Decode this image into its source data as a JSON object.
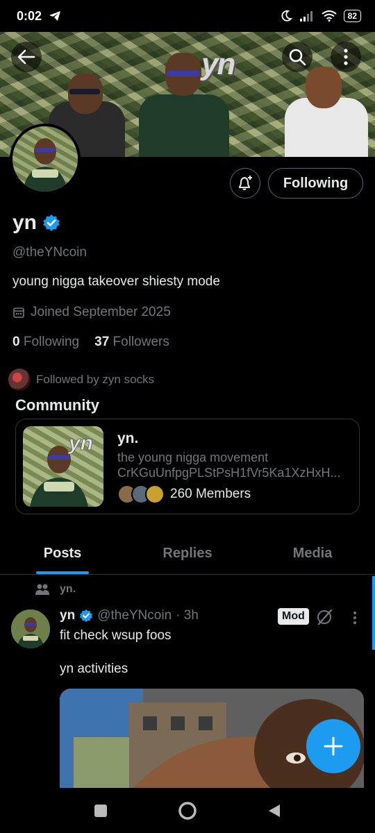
{
  "status_bar": {
    "time": "0:02",
    "battery": "82"
  },
  "banner": {
    "logo_text": "yn"
  },
  "profile": {
    "name": "yn",
    "handle": "@theYNcoin",
    "bio": "young nigga takeover  shiesty mode",
    "joined": "Joined September 2025",
    "following_count": "0",
    "following_label": "Following",
    "followers_count": "37",
    "followers_label": "Followers",
    "followed_by": "Followed by zyn socks",
    "follow_button": "Following"
  },
  "community": {
    "section_title": "Community",
    "name": "yn.",
    "description": "the young nigga movement",
    "address": "CrKGuUnfpgPLStPsH1fVr5Ka1XzHxH...",
    "members": "260 Members",
    "image_logo": "yn"
  },
  "tabs": [
    {
      "label": "Posts",
      "active": true
    },
    {
      "label": "Replies",
      "active": false
    },
    {
      "label": "Media",
      "active": false
    }
  ],
  "post": {
    "context": "yn.",
    "name": "yn",
    "handle": "@theYNcoin",
    "time": "· 3h",
    "badge": "Mod",
    "text": "fit check wsup foos\n\nyn activities"
  },
  "colors": {
    "accent": "#1d9bf0",
    "muted": "#71767b",
    "text": "#e7e9ea"
  }
}
